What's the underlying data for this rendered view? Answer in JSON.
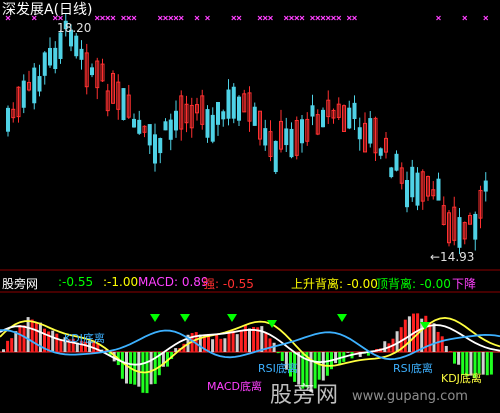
{
  "window": {
    "title": "深发展A(日线)",
    "high_label": "18.20",
    "low_label": "←14.93"
  },
  "indicator": {
    "panel_name": "股旁网",
    "values": [
      {
        "text": ":-0.55",
        "color": "#00ff00"
      },
      {
        "text": ":-1.00",
        "color": "#ffff00"
      },
      {
        "text": "MACD: 0.89",
        "color": "#ff40ff"
      },
      {
        "text": "强: -0.55",
        "color": "#ff3030"
      },
      {
        "text": "上升背离: -0.00",
        "color": "#ffff00"
      },
      {
        "text": "顶背离: -0.00",
        "color": "#00ff00"
      },
      {
        "text": "下降",
        "color": "#ff40ff"
      }
    ],
    "overlay_labels": [
      {
        "text": "KDJ底离",
        "color": "#3db1ff"
      },
      {
        "text": "MACD底离",
        "color": "#ff40ff"
      },
      {
        "text": "RSI底离",
        "color": "#3db1ff"
      },
      {
        "text": "RSI底离",
        "color": "#3db1ff"
      },
      {
        "text": "KDJ底离",
        "color": "#ffff40"
      }
    ]
  },
  "watermark": {
    "text": "股旁网",
    "url": "www.gupang.com"
  },
  "colors": {
    "up": "#ff3030",
    "down": "#4fd2e6",
    "marker": "#ff40ff",
    "signal": "#00ff00"
  }
}
